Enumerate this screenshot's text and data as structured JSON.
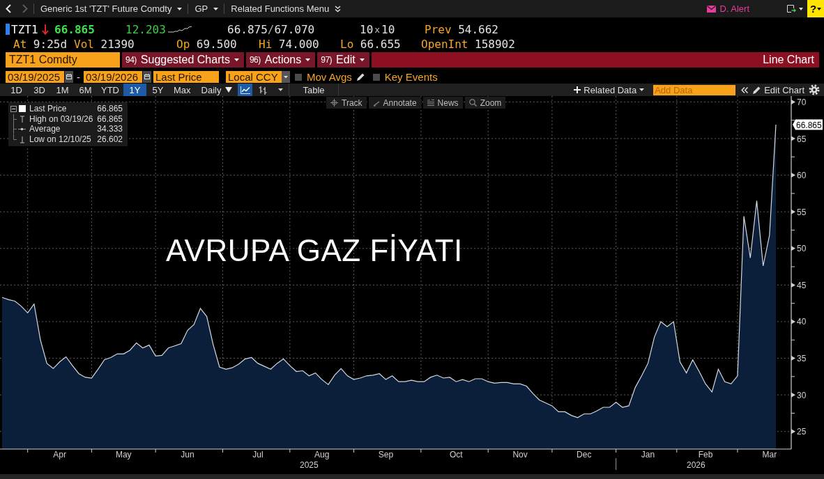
{
  "top_bar": {
    "nav": [
      {
        "kind": "back",
        "disabled": false
      },
      {
        "kind": "forward",
        "disabled": true
      }
    ],
    "security_menu": "Generic 1st 'TZT' Future Comdty",
    "source_menu": "GP",
    "functions_menu": "Related Functions Menu",
    "alert": "D. Alert",
    "help": "?"
  },
  "quote": {
    "ticker": "TZT1",
    "down_tick": true,
    "last": "66.865",
    "change": "12.203",
    "bid": "66.875",
    "bid_ask_separator": "/",
    "ask": "67.070",
    "bid_size": "10",
    "size_separator": "x",
    "ask_size": "10",
    "top_fields": [
      {
        "label": "Prev",
        "value": "54.662"
      }
    ],
    "bottom_fields": [
      {
        "label": "At",
        "value": "9:25d"
      },
      {
        "label": "Vol",
        "value": "21390"
      },
      {
        "label": "Op",
        "value": "69.500"
      },
      {
        "label": "Hi",
        "value": "74.000"
      },
      {
        "label": "Lo",
        "value": "66.655"
      },
      {
        "label": "OpenInt",
        "value": "158902"
      }
    ]
  },
  "command_bar": {
    "security": "TZT1 Comdty",
    "menu_buttons": [
      {
        "number": "94)",
        "label": "Suggested Charts"
      },
      {
        "number": "96)",
        "label": "Actions"
      },
      {
        "number": "97)",
        "label": "Edit"
      }
    ],
    "chart_type": "Line Chart"
  },
  "settings_bar": {
    "start_date": "03/19/2025",
    "separator": "-",
    "end_date": "03/19/2026",
    "field": "Last Price",
    "currency": "Local CCY",
    "options": [
      {
        "kind": "editable",
        "label": "Mov Avgs",
        "checked": false
      },
      {
        "kind": "plain",
        "label": "Key Events",
        "checked": false
      }
    ]
  },
  "toolbar": {
    "periods": [
      {
        "label": "1D",
        "selected": false
      },
      {
        "label": "3D",
        "selected": false
      },
      {
        "label": "1M",
        "selected": false
      },
      {
        "label": "6M",
        "selected": false
      },
      {
        "label": "YTD",
        "selected": false
      },
      {
        "label": "1Y",
        "selected": true
      },
      {
        "label": "5Y",
        "selected": false
      },
      {
        "label": "Max",
        "selected": false
      }
    ],
    "frequency": "Daily",
    "chart_styles": [
      {
        "kind": "line",
        "selected": true
      },
      {
        "kind": "bar",
        "selected": false
      }
    ],
    "table": "Table",
    "related_data": "Related Data",
    "add_data": {
      "placeholder": "Add Data"
    },
    "edit_chart": "Edit Chart"
  },
  "chart": {
    "tools": [
      {
        "kind": "track",
        "label": "Track"
      },
      {
        "kind": "annotate",
        "label": "Annotate"
      },
      {
        "kind": "news",
        "label": "News"
      },
      {
        "kind": "zoom",
        "label": "Zoom"
      }
    ],
    "legend": [
      {
        "kind": "series",
        "value": "66.865"
      },
      {
        "kind": "high",
        "label": "High on 03/19/26",
        "value": "66.865"
      },
      {
        "kind": "average",
        "label": "Average",
        "value": "34.333"
      },
      {
        "kind": "low",
        "label": "Low on 12/10/25",
        "value": "26.602"
      }
    ],
    "overlay_text": "AVRUPA GAZ FİYATI",
    "last_price_tag": "66.865",
    "chart_data": {
      "type": "area",
      "grid": true,
      "categories": [
        null,
        null,
        null,
        null,
        null,
        null,
        null,
        null,
        null,
        "Apr",
        null,
        null,
        null,
        null,
        null,
        null,
        null,
        null,
        null,
        "May",
        null,
        null,
        null,
        null,
        null,
        null,
        null,
        null,
        null,
        "Jun",
        null,
        null,
        null,
        null,
        null,
        null,
        null,
        null,
        null,
        null,
        "Jul",
        null,
        null,
        null,
        null,
        null,
        null,
        null,
        null,
        null,
        "Aug",
        null,
        null,
        null,
        null,
        null,
        null,
        null,
        null,
        null,
        "Sep",
        null,
        null,
        null,
        null,
        null,
        null,
        null,
        null,
        null,
        null,
        "Oct",
        null,
        null,
        null,
        null,
        null,
        null,
        null,
        null,
        null,
        "Nov",
        null,
        null,
        null,
        null,
        null,
        null,
        null,
        null,
        null,
        "Dec",
        null,
        null,
        null,
        null,
        null,
        null,
        null,
        null,
        null,
        "Jan",
        null,
        null,
        null,
        null,
        null,
        null,
        null,
        null,
        "Feb",
        null,
        null,
        null,
        null,
        null,
        null,
        null,
        null,
        null,
        "Mar",
        null
      ],
      "series": [
        {
          "name": "Last Price",
          "color": "#d4d9e0",
          "values": [
            43.3,
            43.0,
            42.8,
            42.1,
            41.2,
            42.4,
            37.5,
            34.3,
            33.6,
            34.5,
            35.2,
            34.0,
            32.9,
            32.4,
            32.3,
            33.5,
            34.8,
            35.1,
            35.6,
            35.6,
            36.1,
            37.1,
            36.4,
            36.8,
            35.3,
            35.4,
            36.4,
            36.7,
            37.0,
            38.8,
            39.6,
            41.8,
            40.7,
            36.9,
            33.8,
            33.5,
            33.7,
            34.2,
            34.9,
            35.1,
            34.3,
            33.9,
            33.5,
            34.3,
            34.9,
            34.0,
            33.2,
            33.3,
            32.6,
            33.0,
            32.1,
            31.4,
            32.7,
            33.6,
            32.6,
            32.1,
            32.3,
            32.6,
            32.7,
            32.9,
            32.1,
            32.6,
            31.8,
            31.8,
            32.0,
            31.8,
            31.8,
            32.4,
            32.7,
            32.3,
            32.4,
            31.8,
            32.1,
            31.8,
            32.2,
            32.2,
            31.8,
            31.6,
            31.7,
            31.7,
            31.5,
            31.5,
            31.2,
            30.2,
            29.3,
            28.9,
            28.5,
            27.7,
            27.7,
            27.2,
            26.9,
            27.4,
            27.4,
            27.8,
            28.3,
            28.3,
            29.0,
            28.3,
            28.5,
            31.0,
            32.6,
            34.3,
            37.9,
            40.0,
            39.3,
            40.0,
            34.5,
            33.0,
            34.8,
            33.2,
            31.5,
            30.4,
            33.5,
            31.8,
            31.5,
            32.6,
            54.4,
            48.7,
            56.5,
            47.6,
            51.8,
            66.9
          ]
        }
      ],
      "ylim": [
        22.6,
        70.8
      ],
      "yticks": [
        25,
        30,
        35,
        40,
        45,
        50,
        55,
        60,
        65,
        70
      ],
      "annotations": [
        "2025",
        "2026"
      ]
    }
  }
}
